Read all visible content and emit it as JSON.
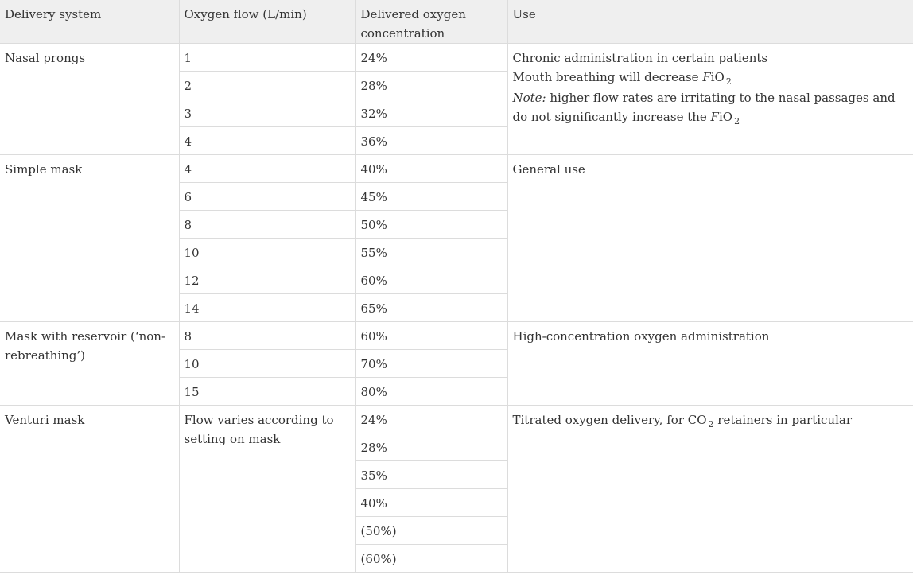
{
  "headers": {
    "system": "Delivery system",
    "flow": "Oxygen flow (L/min)",
    "conc": "Delivered oxygen concentration",
    "use": "Use"
  },
  "nasal": {
    "system": "Nasal prongs",
    "rows": [
      {
        "flow": "1",
        "conc": "24%"
      },
      {
        "flow": "2",
        "conc": "28%"
      },
      {
        "flow": "3",
        "conc": "32%"
      },
      {
        "flow": "4",
        "conc": "36%"
      }
    ],
    "use_line1": "Chronic administration in certain patients",
    "use_line2_pre": "Mouth breathing will decrease ",
    "use_note_label": "Note:",
    "use_note_text": " higher flow rates are irritating to the nasal passages and do not significantly increase the ",
    "fio2_f": "F",
    "fio2_io": "iO",
    "fio2_sub": "2"
  },
  "simple": {
    "system": "Simple mask",
    "rows": [
      {
        "flow": "4",
        "conc": "40%"
      },
      {
        "flow": "6",
        "conc": "45%"
      },
      {
        "flow": "8",
        "conc": "50%"
      },
      {
        "flow": "10",
        "conc": "55%"
      },
      {
        "flow": "12",
        "conc": "60%"
      },
      {
        "flow": "14",
        "conc": "65%"
      }
    ],
    "use": "General use"
  },
  "reservoir": {
    "system": "Mask with reservoir (‘non-rebreathing’)",
    "rows": [
      {
        "flow": "8",
        "conc": "60%"
      },
      {
        "flow": "10",
        "conc": "70%"
      },
      {
        "flow": "15",
        "conc": "80%"
      }
    ],
    "use": "High-concentration oxygen administration"
  },
  "venturi": {
    "system": "Venturi mask",
    "flow": "Flow varies according to setting on mask",
    "rows": [
      {
        "conc": "24%"
      },
      {
        "conc": "28%"
      },
      {
        "conc": "35%"
      },
      {
        "conc": "40%"
      },
      {
        "conc": "(50%)"
      },
      {
        "conc": "(60%)"
      }
    ],
    "use_pre": "Titrated oxygen delivery, for CO",
    "use_sub": "2",
    "use_post": " retainers in particular"
  }
}
